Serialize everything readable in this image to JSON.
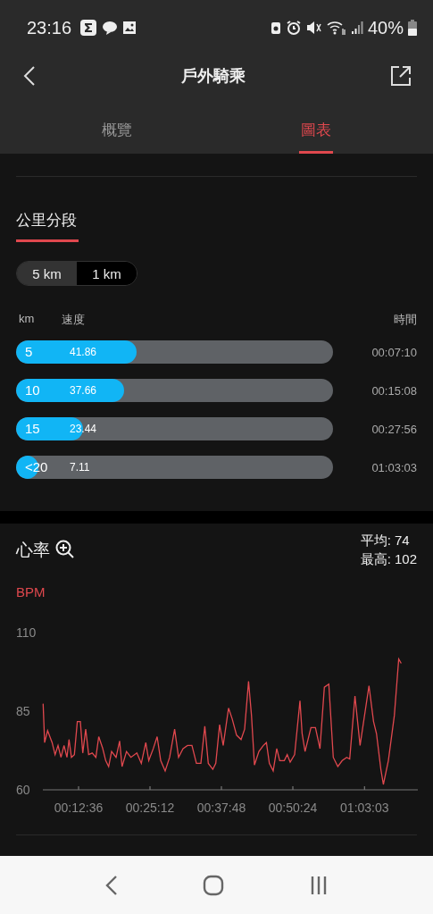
{
  "status_bar": {
    "time": "23:16",
    "battery": "40%"
  },
  "header": {
    "title": "戶外騎乘"
  },
  "tabs": [
    {
      "label": "概覽",
      "selected": false
    },
    {
      "label": "圖表",
      "selected": true
    }
  ],
  "splits": {
    "title": "公里分段",
    "units": [
      {
        "label": "5 km",
        "selected": true
      },
      {
        "label": "1 km",
        "selected": false
      }
    ],
    "columns": [
      "km",
      "速度",
      "時間"
    ],
    "rows": [
      {
        "km": "5",
        "speed": "41.86",
        "level": 0.38,
        "time": "00:07:10"
      },
      {
        "km": "10",
        "speed": "37.66",
        "level": 0.34,
        "time": "00:15:08"
      },
      {
        "km": "15",
        "speed": "23.44",
        "level": 0.21,
        "time": "00:27:56"
      },
      {
        "km": "<20",
        "speed": "7.11",
        "level": 0.07,
        "time": "01:03:03"
      }
    ]
  },
  "heart_rate": {
    "title": "心率",
    "average": "平均: 74",
    "max": "最高: 102",
    "chart_data": {
      "type": "line",
      "ylabel": "BPM",
      "xlim": [
        378,
        4347
      ],
      "ylim": [
        60,
        110
      ],
      "yticks": [
        60,
        85,
        110
      ],
      "xticks": [
        {
          "value": 756,
          "label": "00:12:36"
        },
        {
          "value": 1512,
          "label": "00:25:12"
        },
        {
          "value": 2268,
          "label": "00:37:48"
        },
        {
          "value": 3024,
          "label": "00:50:24"
        },
        {
          "value": 3783,
          "label": "01:03:03"
        }
      ],
      "x": [
        381,
        397,
        428,
        476,
        507,
        539,
        570,
        602,
        633,
        655,
        680,
        712,
        743,
        775,
        800,
        832,
        863,
        901,
        939,
        970,
        1011,
        1043,
        1074,
        1106,
        1153,
        1191,
        1216,
        1263,
        1310,
        1373,
        1420,
        1468,
        1499,
        1547,
        1588,
        1625,
        1673,
        1720,
        1773,
        1814,
        1862,
        1909,
        1956,
        2003,
        2051,
        2092,
        2129,
        2177,
        2208,
        2249,
        2287,
        2344,
        2381,
        2429,
        2476,
        2514,
        2555,
        2586,
        2618,
        2665,
        2712,
        2744,
        2775,
        2816,
        2854,
        2885,
        2933,
        2964,
        2996,
        3043,
        3100,
        3122,
        3153,
        3216,
        3263,
        3311,
        3358,
        3405,
        3452,
        3500,
        3547,
        3594,
        3626,
        3682,
        3736,
        3783,
        3830,
        3878,
        3909,
        3956,
        3982,
        4035,
        4098,
        4145,
        4171
      ],
      "series": [
        {
          "color": "#e0484e",
          "values": [
            87.4,
            75,
            78.8,
            75,
            71.2,
            74.1,
            70.3,
            74.1,
            70.3,
            76,
            70.3,
            71.2,
            81.7,
            81.7,
            71.7,
            79.3,
            71.2,
            71.7,
            70.3,
            76.9,
            73.2,
            69.3,
            67.4,
            72.2,
            70.3,
            75.5,
            67.4,
            72.2,
            70.3,
            71.7,
            68.4,
            75,
            69.3,
            73.1,
            76.9,
            69.3,
            66,
            70.3,
            79.3,
            70.3,
            73.1,
            74.1,
            74.1,
            68.4,
            68.4,
            80.2,
            68.4,
            66.5,
            68.4,
            80.7,
            74.1,
            86,
            82.6,
            77.4,
            76,
            79.3,
            94.5,
            83.6,
            67.9,
            72.2,
            74.1,
            75,
            68.4,
            66,
            73.1,
            69.3,
            69.3,
            71.2,
            68.8,
            71.2,
            88.3,
            77.9,
            72.2,
            79.8,
            79.8,
            73.1,
            92.6,
            93.6,
            70.3,
            67.4,
            69.3,
            70.3,
            69.8,
            89.8,
            74.1,
            83.6,
            93.1,
            81.7,
            77.9,
            66.5,
            61.7,
            69.3,
            83.6,
            101.6,
            100.2
          ]
        }
      ]
    }
  }
}
